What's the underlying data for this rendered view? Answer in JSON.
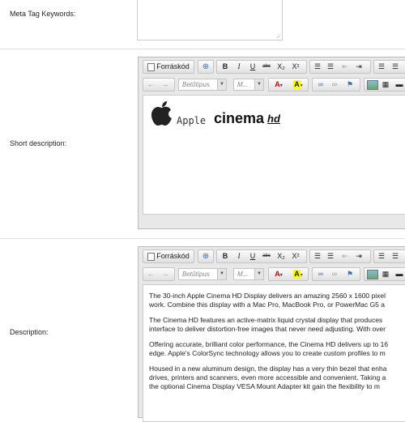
{
  "meta_keywords": {
    "label": "Meta Tag Keywords:"
  },
  "short_description": {
    "label": "Short description:"
  },
  "description": {
    "label": "Description:",
    "paragraphs": [
      "The 30-inch Apple Cinema HD Display delivers an amazing 2560 x 1600 pixel",
      "work. Combine this display with a Mac Pro, MacBook Pro, or PowerMac G5 a",
      "The Cinema HD features an active-matrix liquid crystal display that produces",
      "interface to deliver distortion-free images that never need adjusting. With over",
      "Offering accurate, brilliant color performance, the Cinema HD delivers up to 16",
      "edge. Apple's ColorSync technology allows you to create custom profiles to m",
      "Housed in a new aluminum design, the display has a very thin bezel that enha",
      "drives, printers and scanners, even more accessible and convenient. Taking a",
      "the optional Cinema Display VESA Mount Adapter kit gain the flexibility to m"
    ]
  },
  "toolbar": {
    "source_label": "Forráskód",
    "bold": "B",
    "italic": "I",
    "underline": "U",
    "strike": "abc",
    "subscript": "X₂",
    "superscript": "X²",
    "font_placeholder": "Betűtípus",
    "size_placeholder": "M..."
  },
  "logo": {
    "apple": "Apple",
    "cinema": "cinema",
    "hd": "hd"
  }
}
